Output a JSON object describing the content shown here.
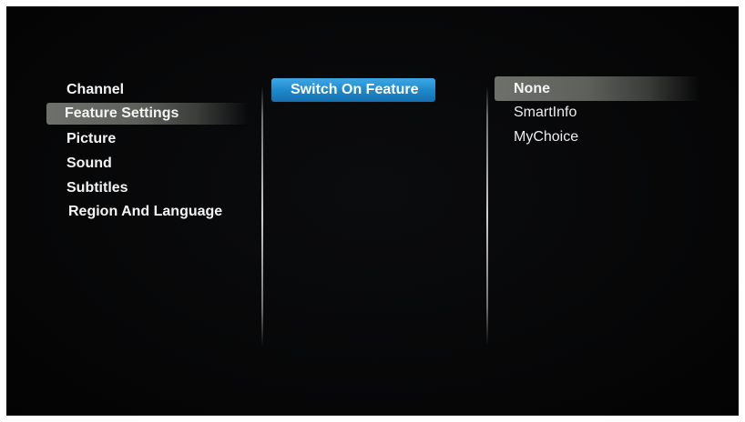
{
  "left_menu": {
    "items": [
      {
        "label": "Channel"
      },
      {
        "label": "Feature Settings"
      },
      {
        "label": "Picture"
      },
      {
        "label": "Sound"
      },
      {
        "label": "Subtitles"
      },
      {
        "label": "Region And Language"
      }
    ],
    "selected_index": 1
  },
  "middle_menu": {
    "items": [
      {
        "label": "Switch On Feature"
      }
    ],
    "selected_index": 0
  },
  "right_menu": {
    "items": [
      {
        "label": "None"
      },
      {
        "label": "SmartInfo"
      },
      {
        "label": "MyChoice"
      }
    ],
    "selected_index": 0
  },
  "colors": {
    "background": "#060607",
    "text": "#f4f4f4",
    "highlight_blue": "#1c86c9",
    "highlight_grey": "#5d605b"
  }
}
